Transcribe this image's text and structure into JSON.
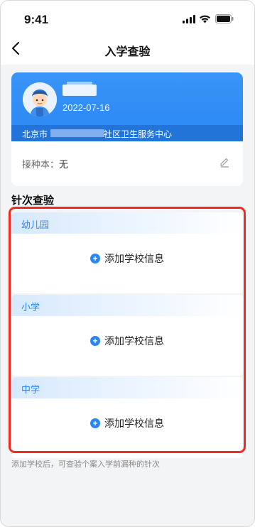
{
  "status": {
    "time": "9:41"
  },
  "nav": {
    "title": "入学查验"
  },
  "child": {
    "dob": "2022-07-16",
    "addr_city": "北京市",
    "addr_rest": "社区卫生服务中心",
    "vaccine_book_label": "接种本：",
    "vaccine_book_value": "无"
  },
  "section": {
    "title": "针次查验"
  },
  "schools": [
    {
      "label": "幼儿园",
      "add_label": "添加学校信息"
    },
    {
      "label": "小学",
      "add_label": "添加学校信息"
    },
    {
      "label": "中学",
      "add_label": "添加学校信息"
    }
  ],
  "note": "添加学校后，可查验个案入学前漏种的针次",
  "colors": {
    "accent": "#2a86f3",
    "highlight": "#ee2a22"
  }
}
